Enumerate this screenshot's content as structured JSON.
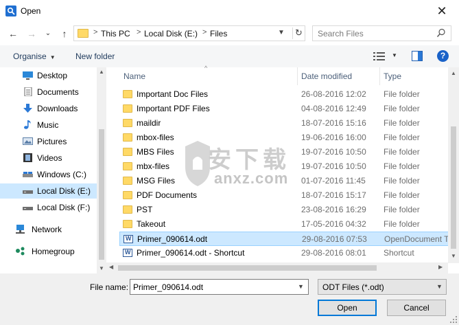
{
  "window": {
    "title": "Open",
    "close_glyph": "✕"
  },
  "nav": {
    "back_glyph": "←",
    "forward_glyph": "→",
    "recent_glyph": "⌄",
    "up_glyph": "↑",
    "breadcrumb": [
      "This PC",
      "Local Disk (E:)",
      "Files"
    ],
    "breadcrumb_sep": ">",
    "refresh_glyph": "↻",
    "search_placeholder": "Search Files"
  },
  "toolbar": {
    "organise_label": "Organise",
    "new_folder_label": "New folder",
    "help_label": "?"
  },
  "sidebar": {
    "items": [
      {
        "label": "Desktop",
        "icon": "desktop-icon"
      },
      {
        "label": "Documents",
        "icon": "documents-icon"
      },
      {
        "label": "Downloads",
        "icon": "downloads-icon"
      },
      {
        "label": "Music",
        "icon": "music-icon"
      },
      {
        "label": "Pictures",
        "icon": "pictures-icon"
      },
      {
        "label": "Videos",
        "icon": "videos-icon"
      },
      {
        "label": "Windows (C:)",
        "icon": "drive-icon"
      },
      {
        "label": "Local Disk (E:)",
        "icon": "drive-icon",
        "selected": true
      },
      {
        "label": "Local Disk (F:)",
        "icon": "drive-icon"
      },
      {
        "label": "Network",
        "icon": "network-icon"
      },
      {
        "label": "Homegroup",
        "icon": "homegroup-icon"
      }
    ]
  },
  "columns": {
    "name": "Name",
    "date": "Date modified",
    "type": "Type"
  },
  "files": [
    {
      "name": "Important Doc Files",
      "date": "26-08-2016 12:02",
      "type": "File folder",
      "icon": "folder-icon"
    },
    {
      "name": "Important PDF Files",
      "date": "04-08-2016 12:49",
      "type": "File folder",
      "icon": "folder-icon"
    },
    {
      "name": "maildir",
      "date": "18-07-2016 15:16",
      "type": "File folder",
      "icon": "folder-icon"
    },
    {
      "name": "mbox-files",
      "date": "19-06-2016 16:00",
      "type": "File folder",
      "icon": "folder-icon"
    },
    {
      "name": "MBS Files",
      "date": "19-07-2016 10:50",
      "type": "File folder",
      "icon": "folder-icon"
    },
    {
      "name": "mbx-files",
      "date": "19-07-2016 10:50",
      "type": "File folder",
      "icon": "folder-icon"
    },
    {
      "name": "MSG Files",
      "date": "01-07-2016 11:45",
      "type": "File folder",
      "icon": "folder-icon"
    },
    {
      "name": "PDF Documents",
      "date": "18-07-2016 15:17",
      "type": "File folder",
      "icon": "folder-icon"
    },
    {
      "name": "PST",
      "date": "23-08-2016 16:29",
      "type": "File folder",
      "icon": "folder-icon"
    },
    {
      "name": "Takeout",
      "date": "17-05-2016 04:32",
      "type": "File folder",
      "icon": "folder-icon"
    },
    {
      "name": "Primer_090614.odt",
      "date": "29-08-2016 07:53",
      "type": "OpenDocument T",
      "icon": "odt-file-icon",
      "selected": true
    },
    {
      "name": "Primer_090614.odt - Shortcut",
      "date": "29-08-2016 08:01",
      "type": "Shortcut",
      "icon": "shortcut-icon"
    }
  ],
  "footer": {
    "filename_label": "File name:",
    "filename_value": "Primer_090614.odt",
    "filetype_value": "ODT Files (*.odt)",
    "open_label": "Open",
    "cancel_label": "Cancel"
  },
  "watermark": {
    "cn": "安下载",
    "text": "anxz.com"
  },
  "colors": {
    "accent": "#0078d7",
    "selection": "#cce8ff",
    "folder": "#ffd966"
  }
}
